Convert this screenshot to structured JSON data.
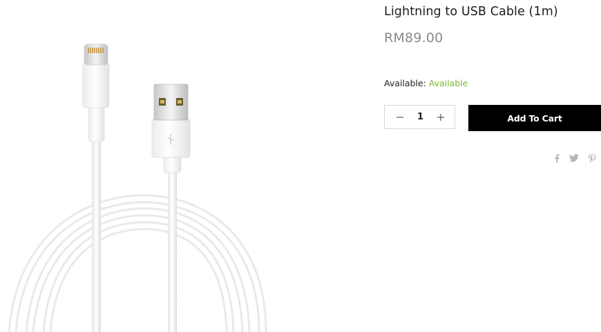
{
  "product": {
    "title": "Lightning to USB Cable (1m)",
    "price": "RM89.00",
    "availability_label": "Available:",
    "availability_status": "Available",
    "quantity": "1",
    "add_to_cart_label": "Add To Cart",
    "image": "lightning-usb-cable-image"
  },
  "share_icons": [
    "facebook-icon",
    "twitter-icon",
    "pinterest-icon"
  ],
  "colors": {
    "button_bg": "#000000",
    "price": "#8a8a8a",
    "available": "#7cb82f",
    "icons": "#b5b5b5"
  }
}
